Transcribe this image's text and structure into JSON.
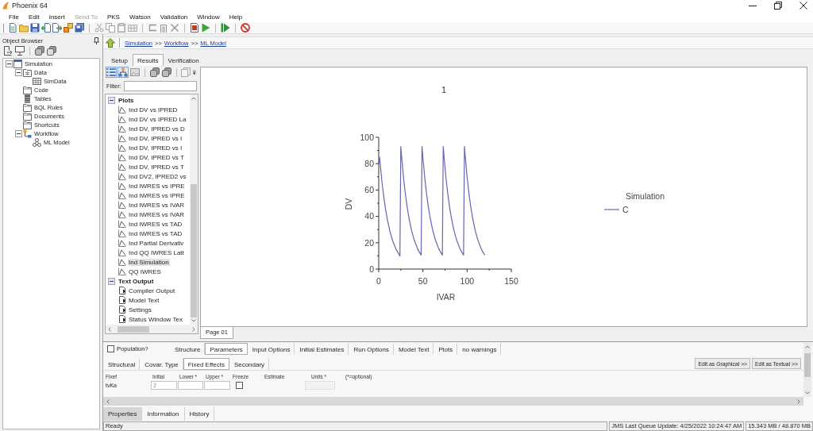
{
  "window": {
    "title": "Phoenix 64"
  },
  "menu": [
    {
      "label": "File",
      "disabled": false
    },
    {
      "label": "Edit",
      "disabled": false
    },
    {
      "label": "Insert",
      "disabled": false
    },
    {
      "label": "Send To",
      "disabled": true
    },
    {
      "label": "PKS",
      "disabled": false
    },
    {
      "label": "Watson",
      "disabled": false
    },
    {
      "label": "Validation",
      "disabled": false
    },
    {
      "label": "Window",
      "disabled": false
    },
    {
      "label": "Help",
      "disabled": false
    }
  ],
  "toolbar": [
    [
      {
        "kind": "document",
        "disabled": false
      },
      {
        "kind": "folder",
        "disabled": false
      },
      {
        "kind": "floppy",
        "disabled": false
      },
      {
        "kind": "import",
        "disabled": false
      },
      {
        "kind": "export",
        "disabled": false
      },
      {
        "kind": "boxes",
        "disabled": false
      },
      {
        "kind": "floppies",
        "disabled": false
      }
    ],
    [
      {
        "kind": "scissors",
        "disabled": true
      },
      {
        "kind": "copy",
        "disabled": true
      },
      {
        "kind": "clipboard",
        "disabled": true
      },
      {
        "kind": "grid",
        "disabled": true
      }
    ],
    [
      {
        "kind": "bracket",
        "disabled": true
      },
      {
        "kind": "arch",
        "disabled": true
      },
      {
        "kind": "cross",
        "disabled": true
      }
    ],
    [
      {
        "kind": "report",
        "disabled": false
      },
      {
        "kind": "play",
        "disabled": false
      }
    ],
    [
      {
        "kind": "step",
        "disabled": false
      }
    ],
    [
      {
        "kind": "prohibited",
        "disabled": false
      }
    ]
  ],
  "object_browser": {
    "title": "Object Browser",
    "tree": [
      {
        "label": "Simulation",
        "kind": "simulation",
        "expanded": true,
        "children": [
          {
            "label": "Data",
            "kind": "datafolder",
            "expanded": true,
            "children": [
              {
                "label": "SimData",
                "kind": "dataset"
              }
            ]
          },
          {
            "label": "Code",
            "kind": "folder"
          },
          {
            "label": "Tables",
            "kind": "tables"
          },
          {
            "label": "BQL Rules",
            "kind": "folder"
          },
          {
            "label": "Documents",
            "kind": "folder"
          },
          {
            "label": "Shortcuts",
            "kind": "folder"
          },
          {
            "label": "Workflow",
            "kind": "workflow",
            "expanded": true,
            "children": [
              {
                "label": "ML Model",
                "kind": "model"
              }
            ]
          }
        ]
      }
    ]
  },
  "breadcrumb": [
    {
      "kind": "link",
      "text": "Simulation"
    },
    {
      "kind": "separator",
      "text": ">>"
    },
    {
      "kind": "link",
      "text": "Workflow"
    },
    {
      "kind": "separator",
      "text": ">>"
    },
    {
      "kind": "link",
      "text": "ML Model"
    }
  ],
  "result_tabs": [
    {
      "label": "Setup",
      "selected": false
    },
    {
      "label": "Results",
      "selected": true
    },
    {
      "label": "Verification",
      "selected": false
    }
  ],
  "results_list": {
    "toolbar": [
      [
        {
          "kind": "list",
          "pressed": true
        },
        {
          "kind": "tree",
          "pressed": true
        },
        {
          "kind": "chart",
          "pressed": false
        }
      ],
      [
        {
          "kind": "stack",
          "pressed": false
        },
        {
          "kind": "stack",
          "pressed": false
        }
      ],
      [
        {
          "kind": "pages",
          "pressed": false
        }
      ]
    ],
    "filter": {
      "label": "Filter:"
    },
    "groups": [
      {
        "label": "Plots",
        "kind": "plot",
        "expanded": true,
        "items": [
          {
            "label": "Ind DV vs IPRED",
            "selected": false
          },
          {
            "label": "Ind DV vs IPRED La",
            "selected": false
          },
          {
            "label": "Ind DV, IPRED vs D",
            "selected": false
          },
          {
            "label": "Ind DV, IPRED vs I",
            "selected": false
          },
          {
            "label": "Ind DV, IPRED vs I",
            "selected": false
          },
          {
            "label": "Ind DV, IPRED vs T",
            "selected": false
          },
          {
            "label": "Ind DV, IPRED vs T",
            "selected": false
          },
          {
            "label": "Ind DV2, IPRED2 vs",
            "selected": false
          },
          {
            "label": "Ind IWRES vs IPRE",
            "selected": false
          },
          {
            "label": "Ind IWRES vs IPRE",
            "selected": false
          },
          {
            "label": "Ind IWRES vs IVAR",
            "selected": false
          },
          {
            "label": "Ind IWRES vs IVAR",
            "selected": false
          },
          {
            "label": "Ind IWRES vs TAD",
            "selected": false
          },
          {
            "label": "Ind IWRES vs TAD",
            "selected": false
          },
          {
            "label": "Ind Partial Derivativ",
            "selected": false
          },
          {
            "label": "Ind QQ IWRES Latt",
            "selected": false
          },
          {
            "label": "Ind Simulation",
            "selected": true
          },
          {
            "label": "QQ IWRES",
            "selected": false
          }
        ]
      },
      {
        "label": "Text Output",
        "kind": "text",
        "expanded": true,
        "items": [
          {
            "label": "Compiler Output",
            "selected": false
          },
          {
            "label": "Model Text",
            "selected": false
          },
          {
            "label": "Settings",
            "selected": false
          },
          {
            "label": "Status Window Tex",
            "selected": false
          }
        ]
      }
    ]
  },
  "plot": {
    "legend_title": "Simulation",
    "chart_data": {
      "type": "line",
      "title": "1",
      "xlabel": "IVAR",
      "ylabel": "DV",
      "x": [
        0,
        1,
        2,
        4,
        6,
        8,
        10,
        13,
        16,
        20,
        24,
        25,
        26,
        28,
        30,
        32,
        34,
        37,
        40,
        44,
        48,
        49,
        50,
        52,
        54,
        56,
        58,
        61,
        64,
        68,
        72,
        73,
        74,
        76,
        78,
        80,
        82,
        85,
        88,
        92,
        96,
        97,
        98,
        100,
        102,
        104,
        106,
        109,
        112,
        116,
        120
      ],
      "series": [
        {
          "name": "C",
          "color": "#6464b4",
          "values": [
            80,
            85,
            77.5,
            64.3,
            53.4,
            44.3,
            36.8,
            27.8,
            21.1,
            14.5,
            10.0,
            93,
            84.6,
            69.9,
            57.8,
            47.8,
            39.6,
            29.7,
            22.4,
            15.3,
            10.5,
            93,
            84.6,
            69.9,
            57.8,
            47.8,
            39.6,
            29.7,
            22.4,
            15.3,
            10.5,
            93,
            84.6,
            69.9,
            57.8,
            47.8,
            39.6,
            29.7,
            22.4,
            15.3,
            10.5,
            93,
            84.6,
            69.9,
            57.8,
            47.8,
            39.6,
            29.7,
            22.4,
            15.3,
            10.5
          ]
        }
      ],
      "xlim": [
        0,
        150
      ],
      "ylim": [
        0,
        100
      ],
      "xticks": [
        0,
        50,
        100,
        150
      ],
      "yticks": [
        0,
        20,
        40,
        60,
        80,
        100
      ]
    }
  },
  "page_tabs": [
    {
      "label": "Page 01",
      "selected": true
    }
  ],
  "model_panel": {
    "population": {
      "label": "Population?",
      "checked": false
    },
    "tabs": [
      {
        "label": "Structure",
        "selected": false
      },
      {
        "label": "Parameters",
        "selected": true
      },
      {
        "label": "Input Options",
        "selected": false
      },
      {
        "label": "Initial Estimates",
        "selected": false
      },
      {
        "label": "Run Options",
        "selected": false
      },
      {
        "label": "Model Text",
        "selected": false
      },
      {
        "label": "Plots",
        "selected": false
      },
      {
        "label": "no warnings",
        "selected": false
      }
    ],
    "subtabs": [
      {
        "label": "Structural",
        "selected": false
      },
      {
        "label": "Covar. Type",
        "selected": false
      },
      {
        "label": "Fixed Effects",
        "selected": true
      },
      {
        "label": "Secondary",
        "selected": false
      }
    ],
    "buttons": [
      "Edit as Graphical >>",
      "Edit as Textual >>"
    ],
    "table": {
      "columns": [
        "Fixef",
        "Initial",
        "Lower *",
        "Upper *",
        "Freeze",
        "Estimate",
        "Units *"
      ],
      "note": "(*=optional)",
      "rows": [
        {
          "name": "tvKa",
          "initial": "2",
          "freeze": false
        }
      ]
    }
  },
  "bottom_tabs": [
    {
      "label": "Properties",
      "selected": true
    },
    {
      "label": "Information",
      "selected": false
    },
    {
      "label": "History",
      "selected": false
    }
  ],
  "status_bar": {
    "message": "Ready",
    "panels": [
      "JMS Last Queue Update: 4/25/2022 10:24:47 AM",
      "15.343 MB / 48.870 MB"
    ]
  }
}
